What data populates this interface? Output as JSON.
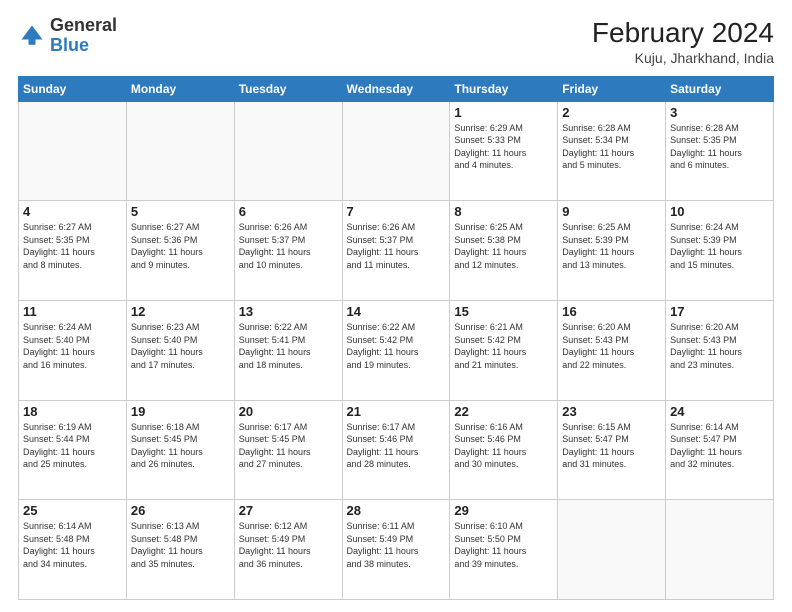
{
  "logo": {
    "general": "General",
    "blue": "Blue"
  },
  "header": {
    "month": "February 2024",
    "location": "Kuju, Jharkhand, India"
  },
  "weekdays": [
    "Sunday",
    "Monday",
    "Tuesday",
    "Wednesday",
    "Thursday",
    "Friday",
    "Saturday"
  ],
  "weeks": [
    [
      {
        "day": "",
        "info": ""
      },
      {
        "day": "",
        "info": ""
      },
      {
        "day": "",
        "info": ""
      },
      {
        "day": "",
        "info": ""
      },
      {
        "day": "1",
        "info": "Sunrise: 6:29 AM\nSunset: 5:33 PM\nDaylight: 11 hours\nand 4 minutes."
      },
      {
        "day": "2",
        "info": "Sunrise: 6:28 AM\nSunset: 5:34 PM\nDaylight: 11 hours\nand 5 minutes."
      },
      {
        "day": "3",
        "info": "Sunrise: 6:28 AM\nSunset: 5:35 PM\nDaylight: 11 hours\nand 6 minutes."
      }
    ],
    [
      {
        "day": "4",
        "info": "Sunrise: 6:27 AM\nSunset: 5:35 PM\nDaylight: 11 hours\nand 8 minutes."
      },
      {
        "day": "5",
        "info": "Sunrise: 6:27 AM\nSunset: 5:36 PM\nDaylight: 11 hours\nand 9 minutes."
      },
      {
        "day": "6",
        "info": "Sunrise: 6:26 AM\nSunset: 5:37 PM\nDaylight: 11 hours\nand 10 minutes."
      },
      {
        "day": "7",
        "info": "Sunrise: 6:26 AM\nSunset: 5:37 PM\nDaylight: 11 hours\nand 11 minutes."
      },
      {
        "day": "8",
        "info": "Sunrise: 6:25 AM\nSunset: 5:38 PM\nDaylight: 11 hours\nand 12 minutes."
      },
      {
        "day": "9",
        "info": "Sunrise: 6:25 AM\nSunset: 5:39 PM\nDaylight: 11 hours\nand 13 minutes."
      },
      {
        "day": "10",
        "info": "Sunrise: 6:24 AM\nSunset: 5:39 PM\nDaylight: 11 hours\nand 15 minutes."
      }
    ],
    [
      {
        "day": "11",
        "info": "Sunrise: 6:24 AM\nSunset: 5:40 PM\nDaylight: 11 hours\nand 16 minutes."
      },
      {
        "day": "12",
        "info": "Sunrise: 6:23 AM\nSunset: 5:40 PM\nDaylight: 11 hours\nand 17 minutes."
      },
      {
        "day": "13",
        "info": "Sunrise: 6:22 AM\nSunset: 5:41 PM\nDaylight: 11 hours\nand 18 minutes."
      },
      {
        "day": "14",
        "info": "Sunrise: 6:22 AM\nSunset: 5:42 PM\nDaylight: 11 hours\nand 19 minutes."
      },
      {
        "day": "15",
        "info": "Sunrise: 6:21 AM\nSunset: 5:42 PM\nDaylight: 11 hours\nand 21 minutes."
      },
      {
        "day": "16",
        "info": "Sunrise: 6:20 AM\nSunset: 5:43 PM\nDaylight: 11 hours\nand 22 minutes."
      },
      {
        "day": "17",
        "info": "Sunrise: 6:20 AM\nSunset: 5:43 PM\nDaylight: 11 hours\nand 23 minutes."
      }
    ],
    [
      {
        "day": "18",
        "info": "Sunrise: 6:19 AM\nSunset: 5:44 PM\nDaylight: 11 hours\nand 25 minutes."
      },
      {
        "day": "19",
        "info": "Sunrise: 6:18 AM\nSunset: 5:45 PM\nDaylight: 11 hours\nand 26 minutes."
      },
      {
        "day": "20",
        "info": "Sunrise: 6:17 AM\nSunset: 5:45 PM\nDaylight: 11 hours\nand 27 minutes."
      },
      {
        "day": "21",
        "info": "Sunrise: 6:17 AM\nSunset: 5:46 PM\nDaylight: 11 hours\nand 28 minutes."
      },
      {
        "day": "22",
        "info": "Sunrise: 6:16 AM\nSunset: 5:46 PM\nDaylight: 11 hours\nand 30 minutes."
      },
      {
        "day": "23",
        "info": "Sunrise: 6:15 AM\nSunset: 5:47 PM\nDaylight: 11 hours\nand 31 minutes."
      },
      {
        "day": "24",
        "info": "Sunrise: 6:14 AM\nSunset: 5:47 PM\nDaylight: 11 hours\nand 32 minutes."
      }
    ],
    [
      {
        "day": "25",
        "info": "Sunrise: 6:14 AM\nSunset: 5:48 PM\nDaylight: 11 hours\nand 34 minutes."
      },
      {
        "day": "26",
        "info": "Sunrise: 6:13 AM\nSunset: 5:48 PM\nDaylight: 11 hours\nand 35 minutes."
      },
      {
        "day": "27",
        "info": "Sunrise: 6:12 AM\nSunset: 5:49 PM\nDaylight: 11 hours\nand 36 minutes."
      },
      {
        "day": "28",
        "info": "Sunrise: 6:11 AM\nSunset: 5:49 PM\nDaylight: 11 hours\nand 38 minutes."
      },
      {
        "day": "29",
        "info": "Sunrise: 6:10 AM\nSunset: 5:50 PM\nDaylight: 11 hours\nand 39 minutes."
      },
      {
        "day": "",
        "info": ""
      },
      {
        "day": "",
        "info": ""
      }
    ]
  ]
}
